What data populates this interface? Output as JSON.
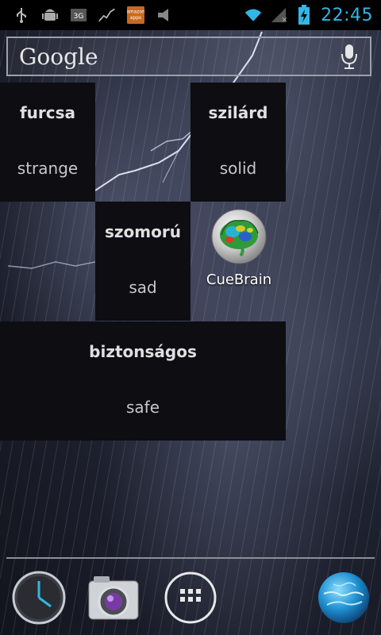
{
  "status_bar": {
    "time": "22:45",
    "icons": [
      "usb-icon",
      "android-debug-icon",
      "3g-icon",
      "stock-chart-icon",
      "amazon-apps-icon",
      "media-icon"
    ],
    "wifi": "wifi-icon",
    "signal": "signal-icon",
    "battery": "battery-icon"
  },
  "search": {
    "logo": "Google"
  },
  "tiles": [
    {
      "word": "furcsa",
      "translation": "strange"
    },
    {
      "word": "szilárd",
      "translation": "solid"
    },
    {
      "word": "szomorú",
      "translation": "sad"
    },
    {
      "word": "biztonságos",
      "translation": "safe"
    }
  ],
  "app": {
    "label": "CueBrain"
  },
  "amazon_label_top": "amazon",
  "amazon_label_bottom": "apps",
  "network_type": "3G",
  "colors": {
    "accent": "#33b5e5",
    "tile_bg": "#0d0d12"
  }
}
